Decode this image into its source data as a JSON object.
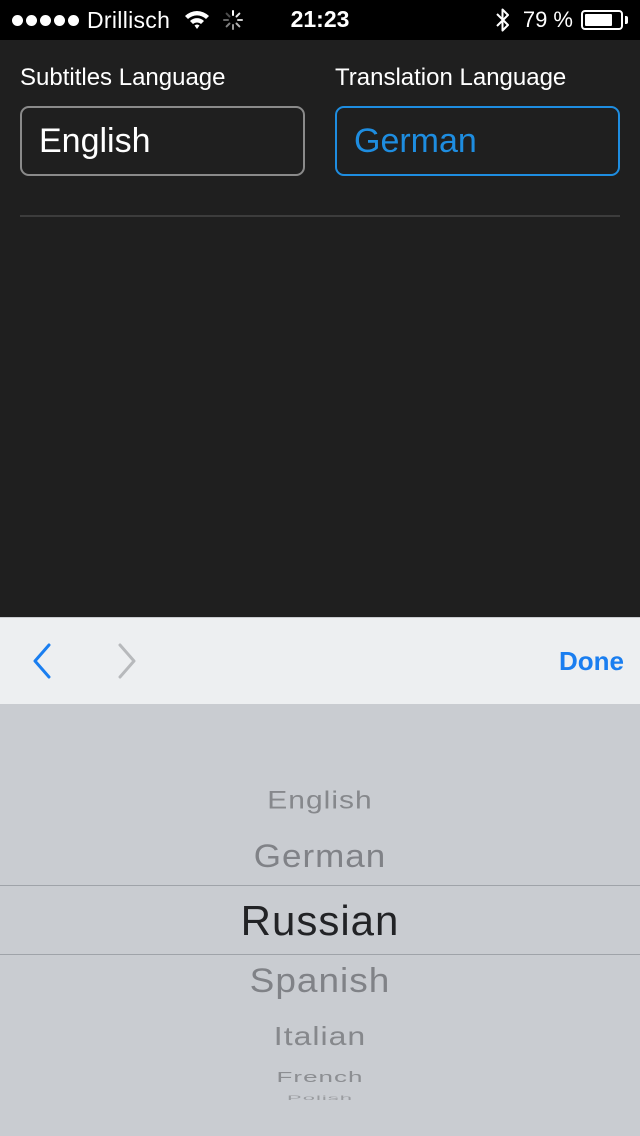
{
  "status_bar": {
    "signal_dots": 5,
    "carrier": "Drillisch",
    "time": "21:23",
    "battery_percent": "79 %",
    "battery_level": 0.79,
    "icons": [
      "wifi-icon",
      "activity-spinner-icon",
      "bluetooth-icon",
      "battery-icon"
    ]
  },
  "form": {
    "subtitles_label": "Subtitles Language",
    "subtitles_value": "English",
    "translation_label": "Translation Language",
    "translation_value": "German"
  },
  "toolbar": {
    "previous_icon": "chevron-left-icon",
    "next_icon": "chevron-right-icon",
    "done_label": "Done"
  },
  "picker": {
    "options": [
      "English",
      "German",
      "Russian",
      "Spanish",
      "Italian",
      "French",
      "Polish"
    ],
    "selected": "Russian"
  },
  "colors": {
    "accent": "#1e8de0",
    "background": "#1f1f1f",
    "picker_bg": "#c9ccd1",
    "toolbar_bg": "#edeff1"
  }
}
